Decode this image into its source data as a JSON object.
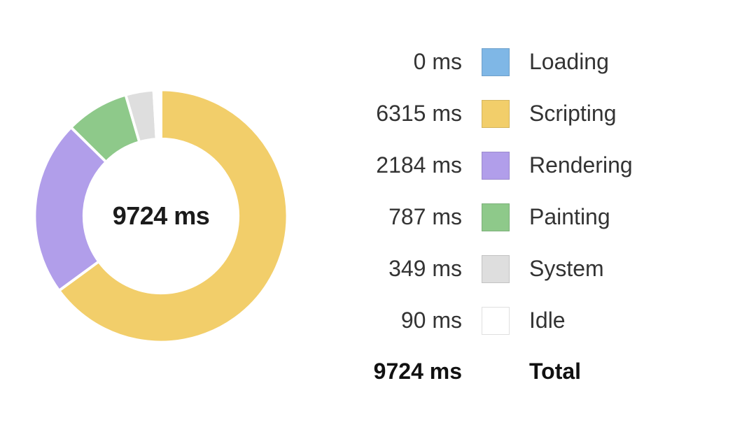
{
  "chart_data": {
    "type": "pie",
    "title": "",
    "unit": "ms",
    "total_value": 9724,
    "total_label": "9724 ms",
    "legend_total_label": "Total",
    "categories": [
      "Loading",
      "Scripting",
      "Rendering",
      "Painting",
      "System",
      "Idle"
    ],
    "values": [
      0,
      6315,
      2184,
      787,
      349,
      90
    ],
    "series": [
      {
        "name": "Loading",
        "value": 0,
        "value_label": "0 ms",
        "color": "#7fb7e6"
      },
      {
        "name": "Scripting",
        "value": 6315,
        "value_label": "6315 ms",
        "color": "#f2ce6a"
      },
      {
        "name": "Rendering",
        "value": 2184,
        "value_label": "2184 ms",
        "color": "#b19eea"
      },
      {
        "name": "Painting",
        "value": 787,
        "value_label": "787 ms",
        "color": "#8ec98a"
      },
      {
        "name": "System",
        "value": 349,
        "value_label": "349 ms",
        "color": "#dedede"
      },
      {
        "name": "Idle",
        "value": 90,
        "value_label": "90 ms",
        "color": "#ffffff"
      }
    ]
  }
}
